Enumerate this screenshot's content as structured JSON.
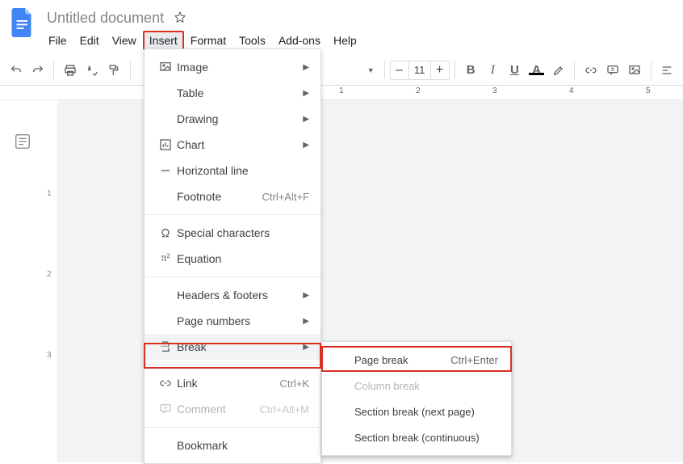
{
  "header": {
    "title": "Untitled document",
    "menus": [
      "File",
      "Edit",
      "View",
      "Insert",
      "Format",
      "Tools",
      "Add-ons",
      "Help"
    ]
  },
  "toolbar": {
    "zoom_caret": "▼",
    "fontsize": {
      "minus": "–",
      "value": "11",
      "plus": "+"
    },
    "bold": "B",
    "italic": "I",
    "underline": "U",
    "textcolor": "A"
  },
  "ruler": {
    "n1": "1",
    "n2": "2",
    "n3": "3",
    "n4": "4",
    "n5": "5"
  },
  "ruler_v": {
    "n1": "1",
    "n2": "2",
    "n3": "3"
  },
  "insert_menu": {
    "image": "Image",
    "table": "Table",
    "drawing": "Drawing",
    "chart": "Chart",
    "hline": "Horizontal line",
    "footnote": {
      "label": "Footnote",
      "short": "Ctrl+Alt+F"
    },
    "special": "Special characters",
    "equation": "Equation",
    "headers": "Headers & footers",
    "pagenums": "Page numbers",
    "break": "Break",
    "link": {
      "label": "Link",
      "short": "Ctrl+K"
    },
    "comment": {
      "label": "Comment",
      "short": "Ctrl+Alt+M"
    },
    "bookmark": "Bookmark"
  },
  "break_submenu": {
    "page": {
      "label": "Page break",
      "short": "Ctrl+Enter"
    },
    "column": "Column break",
    "section_next": "Section break (next page)",
    "section_cont": "Section break (continuous)"
  }
}
